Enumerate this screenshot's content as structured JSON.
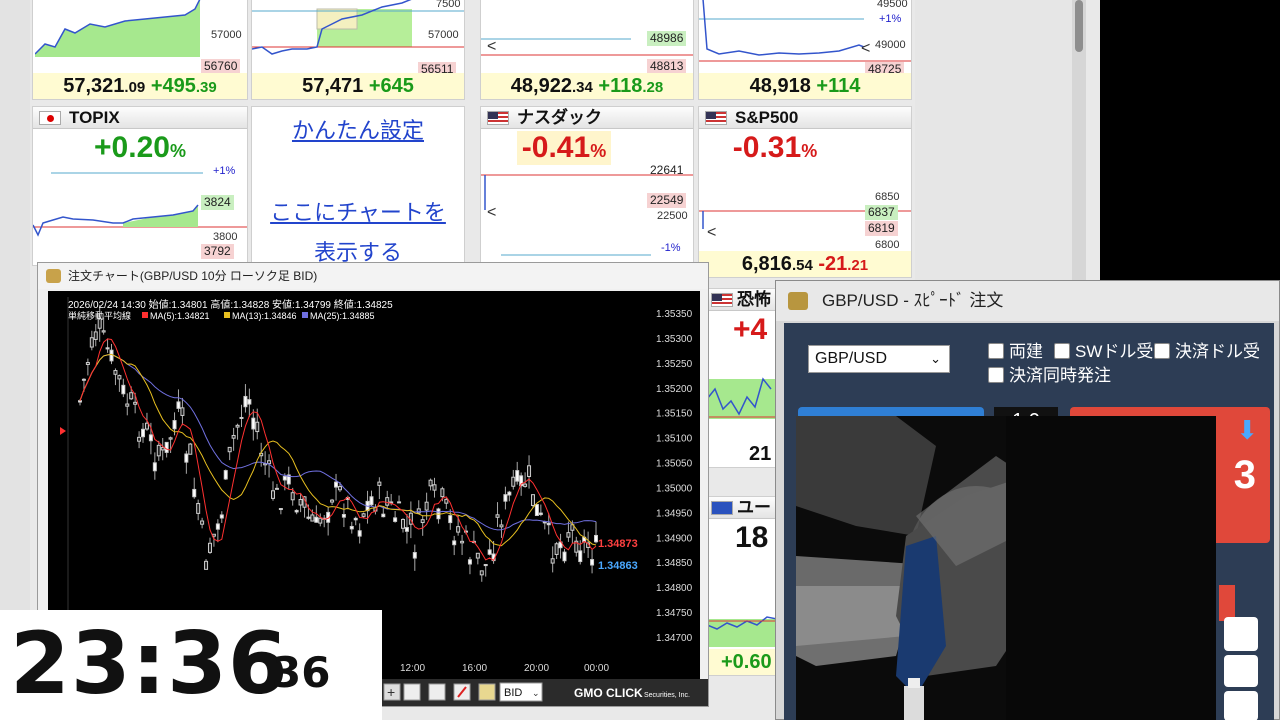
{
  "tiles": {
    "t1": {
      "price": "57,321",
      "price_dec": ".09",
      "change": "+495",
      "change_dec": ".39",
      "axis_top": "57000",
      "axis_bot": "56760"
    },
    "t2": {
      "price": "57,471",
      "change": "+645",
      "axis_top": "7500",
      "axis_mid": "57000",
      "axis_bot": "56511"
    },
    "t3": {
      "price": "48,922",
      "price_dec": ".34",
      "change": "+118",
      "change_dec": ".28",
      "axis_a": "48986",
      "axis_b": "48813"
    },
    "t4": {
      "price": "48,918",
      "change": "+114",
      "axis_a": "49500",
      "axis_pct": "+1%",
      "axis_b": "49000",
      "axis_c": "48725"
    },
    "topix": {
      "name": "TOPIX",
      "pct": "+0.20",
      "pct_unit": "%",
      "axis_pct": "+1%",
      "axis_a": "3824",
      "axis_b": "3800",
      "axis_c": "3792"
    },
    "nasdaq": {
      "name": "ナスダック",
      "pct": "-0.41",
      "pct_unit": "%",
      "axis_a": "22641",
      "axis_b": "22549",
      "axis_c": "22500",
      "axis_pct": "-1%"
    },
    "sp500": {
      "name": "S&P500",
      "pct": "-0.31",
      "pct_unit": "%",
      "axis_a": "6850",
      "axis_b": "6837",
      "axis_c": "6819",
      "axis_d": "6800",
      "price": "6,816",
      "price_dec": ".54",
      "change": "-21",
      "change_dec": ".21"
    },
    "fear": {
      "name": "恐怖",
      "pct": "+4",
      "footer": "21"
    },
    "eur": {
      "name": "ユー",
      "pct": "18"
    },
    "small": {
      "footer": "+0.60"
    }
  },
  "easy": {
    "link1": "かんたん設定",
    "link2": "ここにチャートを",
    "link3": "表示する"
  },
  "chart_window": {
    "title": "注文チャート(GBP/USD 10分 ローソク足 BID)",
    "info_line": "2026/02/24 14:30 始値:1.34801 高値:1.34828 安値:1.34799 終値:1.34825",
    "legend_title": "単純移動平均線",
    "ma5": "MA(5):1.34821",
    "ma13": "MA(13):1.34846",
    "ma25": "MA(25):1.34885",
    "yticks": [
      "1.35350",
      "1.35300",
      "1.35250",
      "1.35200",
      "1.35150",
      "1.35100",
      "1.35050",
      "1.35000",
      "1.34950",
      "1.34900",
      "1.34850",
      "1.34800",
      "1.34750",
      "1.34700"
    ],
    "xticks": [
      "12:00",
      "16:00",
      "20:00",
      "00:00"
    ],
    "ask_tag": "1.34873",
    "bid_tag": "1.34863",
    "price_type": "BID",
    "brand": "GMO CLICK",
    "brand_sub": "Securities, Inc.",
    "colors": {
      "ma5": "#ff3030",
      "ma13": "#e8c020",
      "ma25": "#7070e0"
    }
  },
  "order_window": {
    "title": "GBP/USD - ｽﾋﾟｰﾄﾞ 注文",
    "pair": "GBP/USD",
    "cb1": "両建",
    "cb2": "SWドル受",
    "cb3": "決済ドル受",
    "cb4": "決済同時発注",
    "qty": "1.0",
    "sell_digit": "3"
  },
  "clock": {
    "hm": "23:36",
    "sec": "36"
  }
}
